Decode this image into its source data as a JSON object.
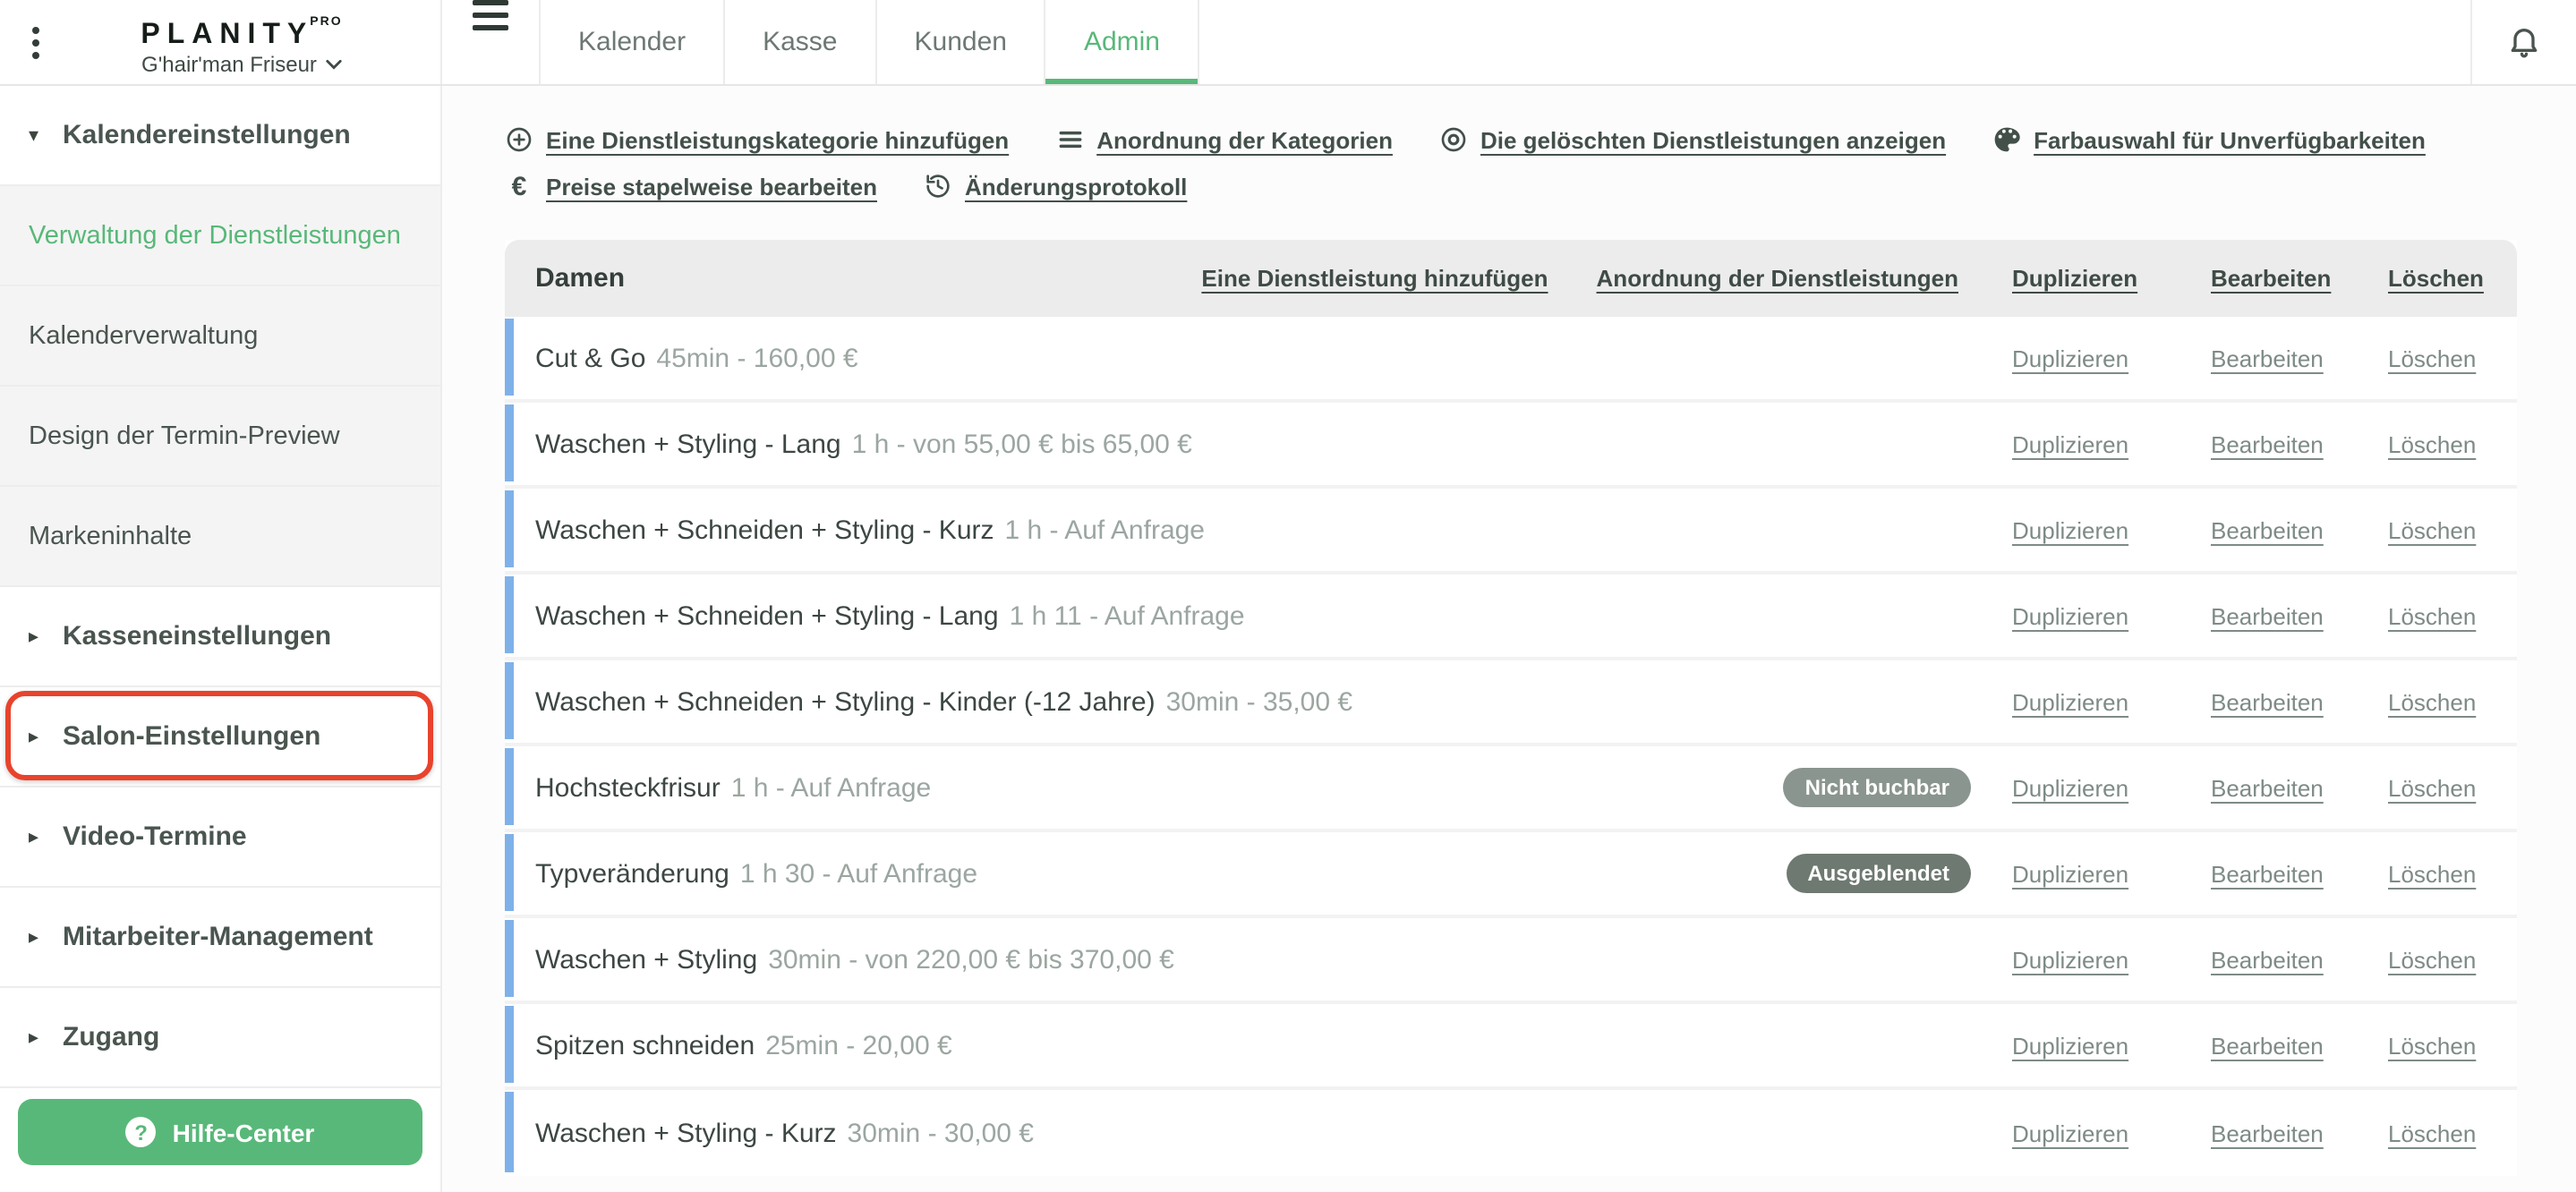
{
  "topbar": {
    "logo": "PLANITY",
    "logo_badge": "PRO",
    "salon_name": "G'hair'man Friseur",
    "tabs": [
      {
        "label": "Kalender",
        "active": false
      },
      {
        "label": "Kasse",
        "active": false
      },
      {
        "label": "Kunden",
        "active": false
      },
      {
        "label": "Admin",
        "active": true
      }
    ]
  },
  "sidebar": {
    "items": [
      {
        "label": "Kalendereinstellungen",
        "type": "section",
        "expanded": true
      },
      {
        "label": "Verwaltung der Dienstleistungen",
        "type": "subitem",
        "active": true
      },
      {
        "label": "Kalenderverwaltung",
        "type": "subitem"
      },
      {
        "label": "Design der Termin-Preview",
        "type": "subitem"
      },
      {
        "label": "Markeninhalte",
        "type": "subitem"
      },
      {
        "label": "Kasseneinstellungen",
        "type": "section"
      },
      {
        "label": "Salon-Einstellungen",
        "type": "section",
        "annotated": true
      },
      {
        "label": "Video-Termine",
        "type": "section"
      },
      {
        "label": "Mitarbeiter-Management",
        "type": "section"
      },
      {
        "label": "Zugang",
        "type": "section"
      }
    ],
    "help_button": {
      "label": "Hilfe-Center",
      "icon": "question-circle"
    }
  },
  "toolbar": {
    "links": [
      {
        "label": "Eine Dienstleistungskategorie hinzufügen",
        "icon": "plus-circle"
      },
      {
        "label": "Anordnung der Kategorien",
        "icon": "list"
      },
      {
        "label": "Die gelöschten Dienstleistungen anzeigen",
        "icon": "eye"
      },
      {
        "label": "Farbauswahl für Unverfügbarkeiten",
        "icon": "palette"
      },
      {
        "label": "Preise stapelweise bearbeiten",
        "icon": "euro"
      },
      {
        "label": "Änderungsprotokoll",
        "icon": "history"
      }
    ]
  },
  "table": {
    "category_title": "Damen",
    "header_links": {
      "add_service": "Eine Dienstleistung hinzufügen",
      "order_services": "Anordnung der Dienstleistungen"
    },
    "actions": {
      "duplicate": "Duplizieren",
      "edit": "Bearbeiten",
      "delete": "Löschen"
    },
    "rows": [
      {
        "name": "Cut & Go",
        "detail": "45min - 160,00 €"
      },
      {
        "name": "Waschen + Styling - Lang",
        "detail": "1 h - von 55,00 € bis 65,00 €"
      },
      {
        "name": "Waschen + Schneiden + Styling - Kurz",
        "detail": "1 h - Auf Anfrage"
      },
      {
        "name": "Waschen + Schneiden + Styling - Lang",
        "detail": "1 h 11 - Auf Anfrage"
      },
      {
        "name": "Waschen + Schneiden + Styling - Kinder (-12 Jahre)",
        "detail": "30min - 35,00 €"
      },
      {
        "name": "Hochsteckfrisur",
        "detail": "1 h - Auf Anfrage",
        "badge": "Nicht buchbar",
        "badge_color": "#8b958f"
      },
      {
        "name": "Typveränderung",
        "detail": "1 h 30 - Auf Anfrage",
        "badge": "Ausgeblendet",
        "badge_color": "#6e7971"
      },
      {
        "name": "Waschen + Styling",
        "detail": "30min - von 220,00 € bis 370,00 €"
      },
      {
        "name": "Spitzen schneiden",
        "detail": "25min - 20,00 €"
      },
      {
        "name": "Waschen + Styling - Kurz",
        "detail": "30min - 30,00 €"
      }
    ]
  },
  "colors": {
    "accent_green": "#58b879",
    "row_stripe_blue": "#7fb1e9",
    "annotation_red": "#e8432c"
  }
}
